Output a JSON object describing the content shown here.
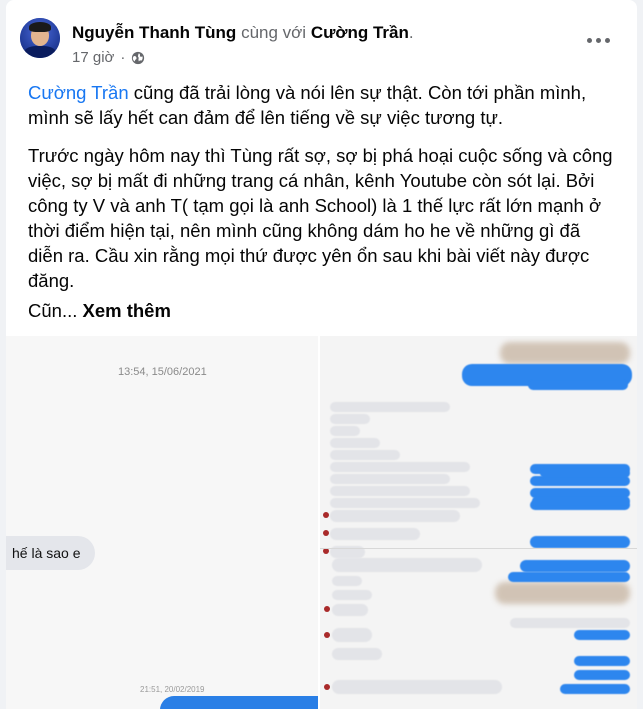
{
  "post": {
    "author": "Nguyễn Thanh Tùng",
    "with_text": "cùng với",
    "tagged": "Cường Trần",
    "tagged_suffix": ".",
    "time": "17 giờ",
    "separator": "·",
    "privacy_icon": "globe-icon",
    "menu_icon": "more-icon",
    "p1_link": "Cường Trần",
    "p1_rest": " cũng đã trải lòng và nói lên sự thật. Còn tới phần mình, mình sẽ lấy hết can đảm để lên tiếng về sự việc tương tự.",
    "p2": "Trước ngày hôm nay thì Tùng rất sợ, sợ bị phá hoại cuộc sống và công việc, sợ bị mất đi những trang cá nhân, kênh Youtube còn sót lại. Bởi công ty V và anh T( tạm gọi là anh School) là 1 thế lực rất lớn mạnh ở thời điểm hiện tại, nên mình cũng không dám ho he về những gì đã diễn ra. Cầu xin rằng mọi thứ được yên ổn sau khi bài viết này được đăng.",
    "p3_prefix": "Cũn...",
    "see_more": "Xem thêm"
  },
  "photos": {
    "left_timestamp": "13:54, 15/06/2021",
    "left_bubble": "hế là sao e",
    "left_timestamp_2": "21:51, 20/02/2019"
  },
  "colors": {
    "link": "#1877f2",
    "muted": "#65676b",
    "messenger_blue": "#2d86ee"
  }
}
